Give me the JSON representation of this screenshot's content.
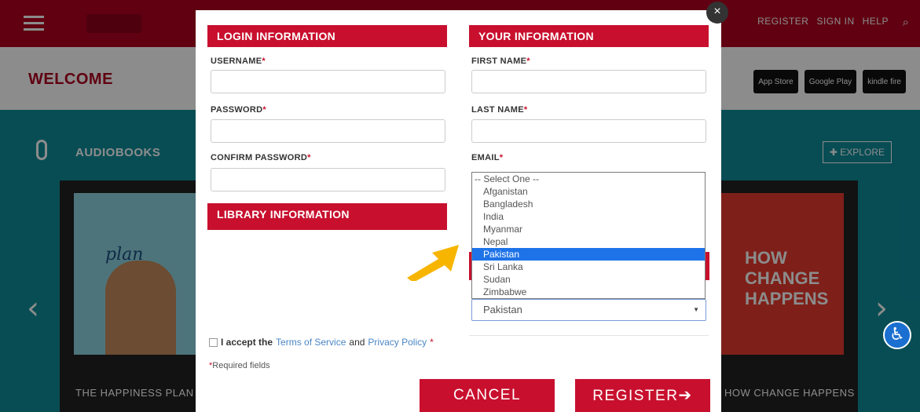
{
  "background": {
    "top_nav": [
      "REGISTER",
      "SIGN IN",
      "HELP"
    ],
    "welcome": "WELCOME",
    "store_badges": [
      "App Store",
      "Google Play",
      "kindle fire"
    ],
    "section_title": "AUDIOBOOKS",
    "explore_label": "EXPLORE",
    "book_left_caption": "THE HAPPINESS PLAN",
    "book_left_cover_text": "plan",
    "book_right_caption": "HOW CHANGE HAPPENS",
    "book_right_cover_text": "HOW CHANGE HAPPENS"
  },
  "modal": {
    "close_label": "×",
    "login_section": {
      "title": "LOGIN INFORMATION",
      "username_label": "USERNAME",
      "password_label": "PASSWORD",
      "confirm_password_label": "CONFIRM PASSWORD",
      "username_value": "",
      "password_value": "",
      "confirm_password_value": ""
    },
    "your_info_section": {
      "title": "YOUR INFORMATION",
      "first_name_label": "FIRST NAME",
      "last_name_label": "LAST NAME",
      "email_label": "EMAIL",
      "first_name_value": "",
      "last_name_value": ""
    },
    "library_section": {
      "title": "LIBRARY INFORMATION"
    },
    "country_dropdown": {
      "options": [
        "-- Select One --",
        "Afganistan",
        "Bangladesh",
        "India",
        "Myanmar",
        "Nepal",
        "Pakistan",
        "Sri Lanka",
        "Sudan",
        "Zimbabwe"
      ],
      "highlighted": "Pakistan",
      "selected_value": "Pakistan"
    },
    "terms": {
      "prefix": "I accept the",
      "terms_link": "Terms of Service",
      "and": "and",
      "privacy_link": "Privacy Policy",
      "required_mark": "*"
    },
    "required_note": "Required fields",
    "required_asterisk": "*",
    "cancel_label": "CANCEL",
    "register_label": "REGISTER"
  },
  "colors": {
    "brand_red": "#c8102e",
    "selection_blue": "#1e73e8",
    "annotation_arrow": "#f7b500"
  }
}
